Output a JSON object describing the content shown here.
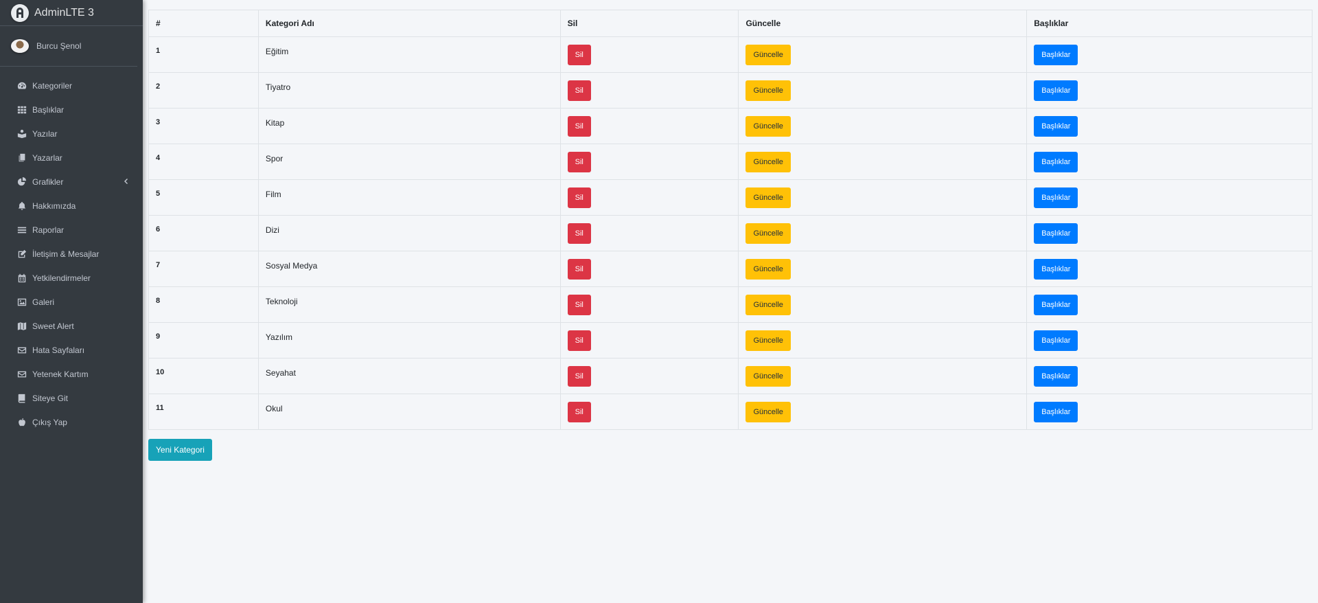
{
  "brand": {
    "title": "AdminLTE 3"
  },
  "user": {
    "name": "Burcu Şenol"
  },
  "sidebar": {
    "items": [
      {
        "label": "Kategoriler",
        "icon": "tachometer-icon"
      },
      {
        "label": "Başlıklar",
        "icon": "grid-icon"
      },
      {
        "label": "Yazılar",
        "icon": "book-reader-icon"
      },
      {
        "label": "Yazarlar",
        "icon": "copy-icon"
      },
      {
        "label": "Grafikler",
        "icon": "chart-pie-icon"
      },
      {
        "label": "Hakkımızda",
        "icon": "bell-icon"
      },
      {
        "label": "Raporlar",
        "icon": "bars-icon"
      },
      {
        "label": "İletişim & Mesajlar",
        "icon": "edit-icon"
      },
      {
        "label": "Yetkilendirmeler",
        "icon": "calendar-icon"
      },
      {
        "label": "Galeri",
        "icon": "image-icon"
      },
      {
        "label": "Sweet Alert",
        "icon": "map-icon"
      },
      {
        "label": "Hata Sayfaları",
        "icon": "envelope-icon"
      },
      {
        "label": "Yetenek Kartım",
        "icon": "envelope-icon"
      },
      {
        "label": "Siteye Git",
        "icon": "book-icon"
      },
      {
        "label": "Çıkış Yap",
        "icon": "apple-icon"
      }
    ]
  },
  "table": {
    "headers": [
      "#",
      "Kategori Adı",
      "Sil",
      "Güncelle",
      "Başlıklar"
    ],
    "rows": [
      {
        "id": "1",
        "name": "Eğitim"
      },
      {
        "id": "2",
        "name": "Tiyatro"
      },
      {
        "id": "3",
        "name": "Kitap"
      },
      {
        "id": "4",
        "name": "Spor"
      },
      {
        "id": "5",
        "name": "Film"
      },
      {
        "id": "6",
        "name": "Dizi"
      },
      {
        "id": "7",
        "name": "Sosyal Medya"
      },
      {
        "id": "8",
        "name": "Teknoloji"
      },
      {
        "id": "9",
        "name": "Yazılım"
      },
      {
        "id": "10",
        "name": "Seyahat"
      },
      {
        "id": "11",
        "name": "Okul"
      }
    ],
    "delete_label": "Sil",
    "update_label": "Güncelle",
    "titles_label": "Başlıklar"
  },
  "new_category_label": "Yeni Kategori",
  "colors": {
    "sidebar": "#343a40",
    "danger": "#dc3545",
    "warning": "#ffc107",
    "primary": "#007bff",
    "info": "#17a2b8"
  }
}
